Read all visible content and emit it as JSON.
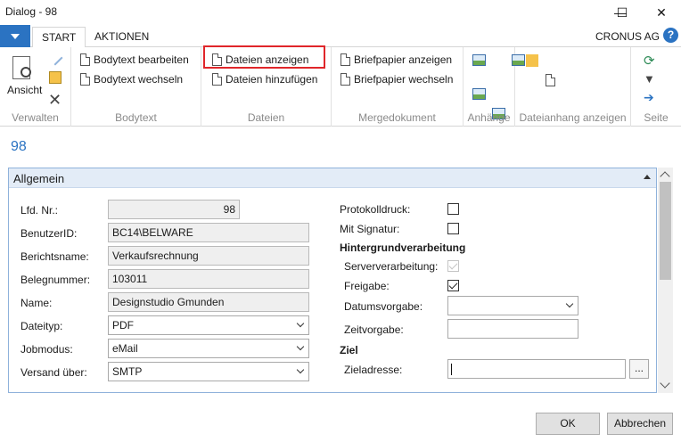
{
  "window": {
    "title": "Dialog - 98",
    "minimize": "—",
    "maximize": "☐",
    "close": "✕"
  },
  "tabs": {
    "start": "START",
    "actions": "AKTIONEN"
  },
  "company": "CRONUS AG",
  "help": "?",
  "ribbon": {
    "groups": {
      "verwalten": "Verwalten",
      "bodytext": "Bodytext",
      "dateien": "Dateien",
      "mergedokument": "Mergedokument",
      "anhaenge": "Anhänge",
      "dateianhang": "Dateianhang anzeigen",
      "seite": "Seite"
    },
    "ansicht": "Ansicht",
    "bodytext_bearbeiten": "Bodytext bearbeiten",
    "bodytext_wechseln": "Bodytext wechseln",
    "dateien_anzeigen": "Dateien anzeigen",
    "dateien_hinzufuegen": "Dateien hinzufügen",
    "briefpapier_anzeigen": "Briefpapier anzeigen",
    "briefpapier_wechseln": "Briefpapier wechseln"
  },
  "page_title": "98",
  "panel": {
    "title": "Allgemein",
    "fields": {
      "lfd_nr_label": "Lfd. Nr.:",
      "lfd_nr": "98",
      "benutzerid_label": "BenutzerID:",
      "benutzerid": "BC14\\BELWARE",
      "berichtsname_label": "Berichtsname:",
      "berichtsname": "Verkaufsrechnung",
      "belegnummer_label": "Belegnummer:",
      "belegnummer": "103011",
      "name_label": "Name:",
      "name": "Designstudio Gmunden",
      "dateityp_label": "Dateityp:",
      "dateityp": "PDF",
      "jobmodus_label": "Jobmodus:",
      "jobmodus": "eMail",
      "versand_label": "Versand über:",
      "versand": "SMTP"
    },
    "right": {
      "protokolldruck": "Protokolldruck:",
      "mit_signatur": "Mit Signatur:",
      "hintergrund": "Hintergrundverarbeitung",
      "serververarbeitung": "Serververarbeitung:",
      "freigabe": "Freigabe:",
      "datumsvorgabe": "Datumsvorgabe:",
      "zeitvorgabe": "Zeitvorgabe:",
      "ziel": "Ziel",
      "zieladresse": "Zieladresse:",
      "ellipsis": "..."
    }
  },
  "footer": {
    "ok": "OK",
    "cancel": "Abbrechen"
  }
}
